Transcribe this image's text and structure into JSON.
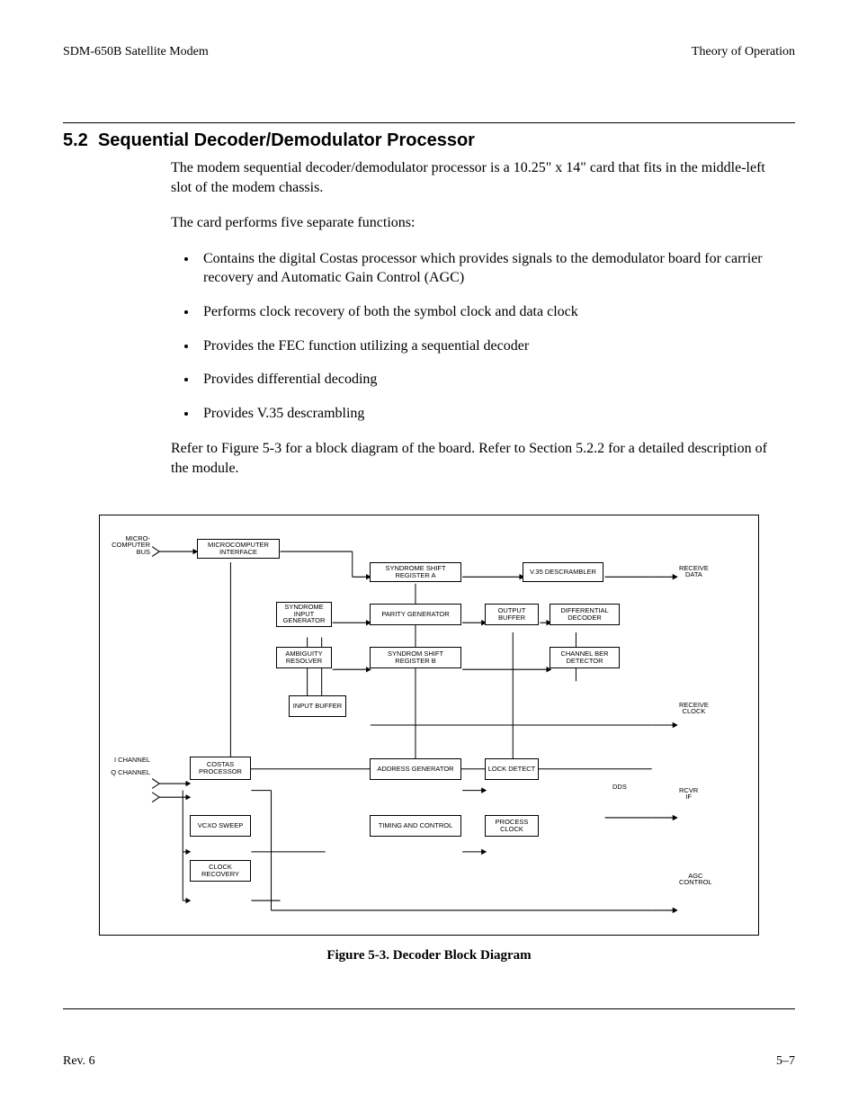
{
  "header": {
    "left": "SDM-650B Satellite Modem",
    "right": "Theory of Operation"
  },
  "section": {
    "number": "5.2",
    "title": "Sequential Decoder/Demodulator Processor"
  },
  "para1": "The modem sequential decoder/demodulator processor is a 10.25\" x 14\" card that fits in the middle-left slot of the modem chassis.",
  "para2": "The card performs five separate functions:",
  "functions": [
    "Contains the digital Costas processor which provides signals to the demodulator board for carrier recovery and Automatic Gain Control (AGC)",
    "Performs clock recovery of both the symbol clock and data clock",
    "Provides the FEC function utilizing a sequential decoder",
    "Provides differential decoding",
    "Provides V.35 descrambling"
  ],
  "para3": "Refer to Figure 5-3 for a block diagram of the board. Refer to Section 5.2.2 for a detailed description of the module.",
  "figure": {
    "caption": "Figure 5-3.  Decoder Block Diagram",
    "io_labels": {
      "micro_bus": "MICRO-\nCOMPUTER\nBUS",
      "i_channel": "I CHANNEL",
      "q_channel": "Q CHANNEL",
      "receive_data": "RECEIVE\nDATA",
      "receive_clock": "RECEIVE\nCLOCK",
      "rcvr_if": "RCVR\nIF",
      "agc_control": "AGC\nCONTROL",
      "dds": "DDS"
    },
    "blocks": {
      "micro_if": "MICROCOMPUTER\nINTERFACE",
      "ssr_a": "SYNDROME SHIFT\nREGISTER A",
      "v35": "V.35\nDESCRAMBLER",
      "syn_in": "SYNDROME\nINPUT\nGENERATOR",
      "parity": "PARITY\nGENERATOR",
      "out_buf": "OUTPUT\nBUFFER",
      "diff_dec": "DIFFERENTIAL\nDECODER",
      "ambig": "AMBIGUITY\nRESOLVER",
      "ssr_b": "SYNDROM SHIFT\nREGISTER B",
      "ch_ber": "CHANNEL BER\nDETECTOR",
      "in_buf": "INPUT\nBUFFER",
      "costas": "COSTAS\nPROCESSOR",
      "addr_gen": "ADDRESS\nGENERATOR",
      "lock": "LOCK\nDETECT",
      "vcxo": "VCXO\nSWEEP",
      "timing": "TIMING AND\nCONTROL",
      "proc_clk": "PROCESS\nCLOCK",
      "clk_rec": "CLOCK\nRECOVERY"
    }
  },
  "footer": {
    "left": "Rev. 6",
    "right": "5–7"
  }
}
